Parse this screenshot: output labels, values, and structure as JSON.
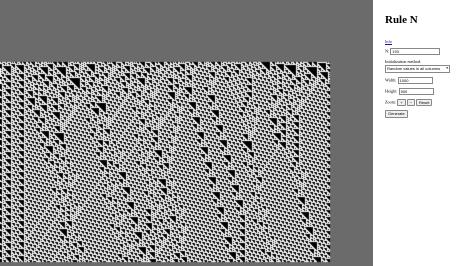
{
  "colors": {
    "background": "#6b6b6b",
    "cell_on": "#000000",
    "cell_off": "#ffffff",
    "link": "#1a0dab"
  },
  "panel": {
    "title": "Rule N",
    "info_link": "Info",
    "n_label": "N:",
    "n_value": "193",
    "init_label": "Initialization method:",
    "init_selected": "Random values in all columns",
    "width_label": "Width:",
    "width_value": "1000",
    "height_label": "Height:",
    "height_value": "500",
    "zoom_label": "Zoom:",
    "zoom_in": "+",
    "zoom_out": "−",
    "zoom_reset": "Reset",
    "generate_label": "Generate"
  }
}
